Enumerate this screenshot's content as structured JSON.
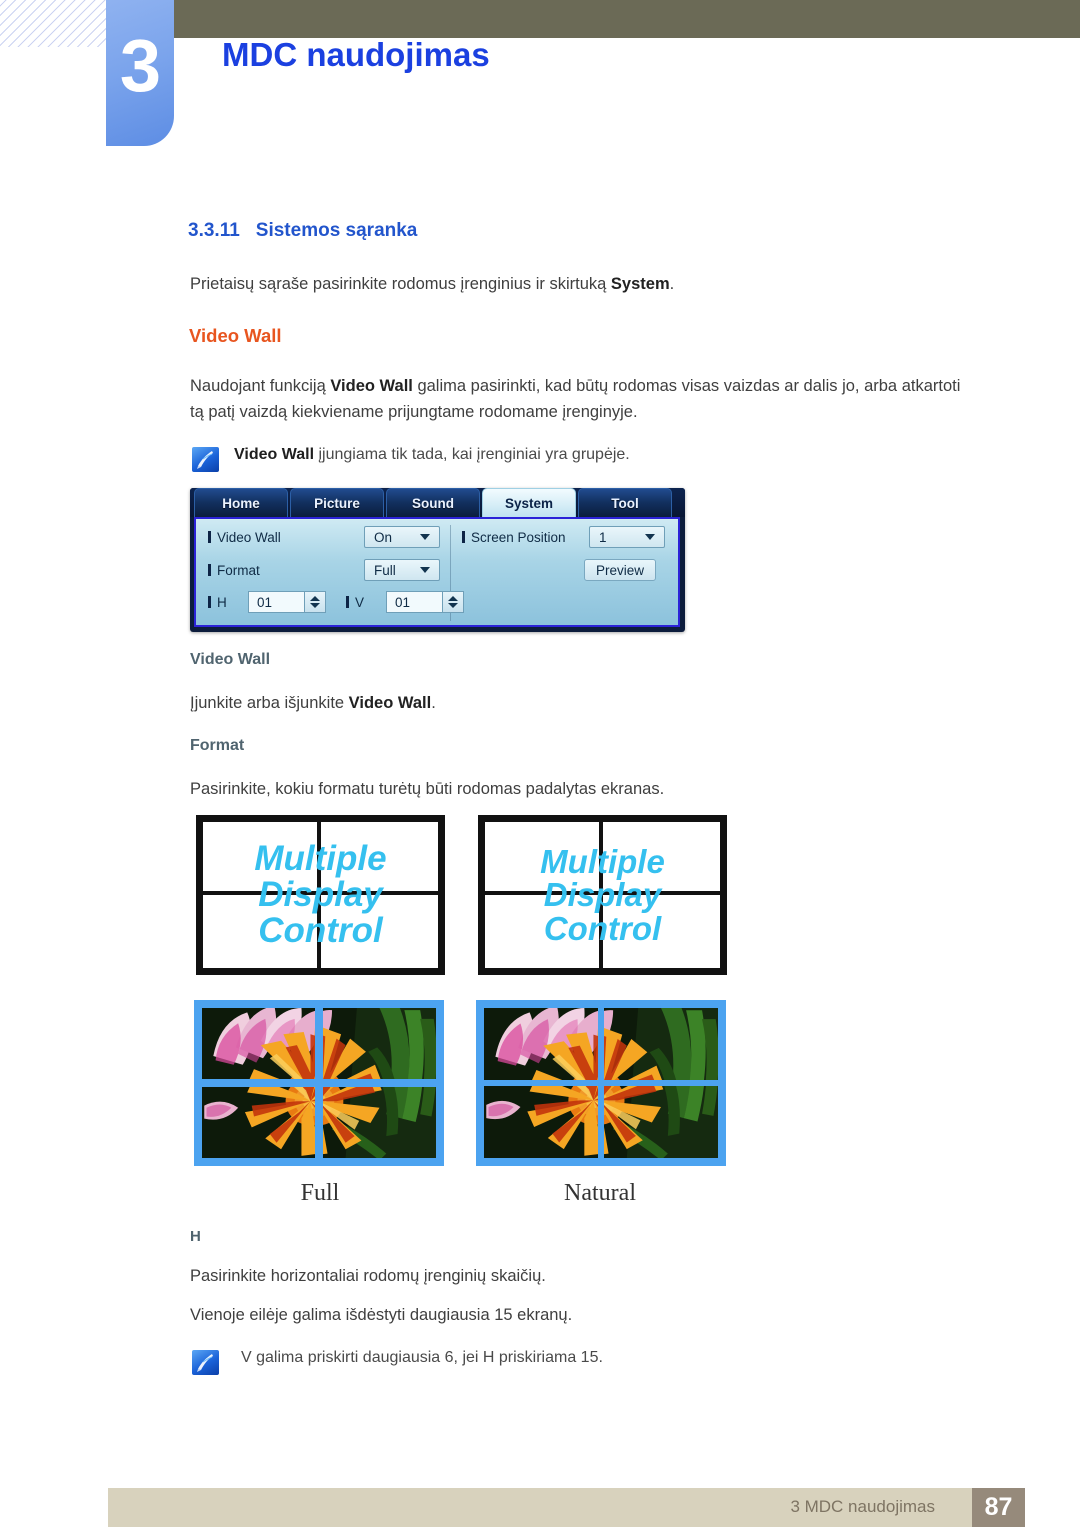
{
  "header": {
    "chapter_number": "3",
    "chapter_title": "MDC naudojimas"
  },
  "section": {
    "number": "3.3.11",
    "title": "Sistemos sąranka",
    "intro_before": "Prietaisų sąraše pasirinkite rodomus įrenginius ir skirtuką ",
    "intro_bold": "System",
    "intro_after": "."
  },
  "video_wall_heading": "Video Wall",
  "video_wall_para_line1_a": "Naudojant funkciją ",
  "video_wall_para_line1_b": "Video Wall",
  "video_wall_para_line1_c": " galima pasirinkti, kad būtų rodomas visas vaizdas ar dalis jo, arba atkartoti",
  "video_wall_para_line2": "tą patį vaizdą kiekviename prijungtame rodomame įrenginyje.",
  "note1": {
    "icon": "note-pen-icon",
    "bold": "Video Wall",
    "rest": " įjungiama tik tada, kai įrenginiai yra grupėje."
  },
  "mdc_panel": {
    "tabs": [
      {
        "label": "Home",
        "active": false
      },
      {
        "label": "Picture",
        "active": false
      },
      {
        "label": "Sound",
        "active": false
      },
      {
        "label": "System",
        "active": true
      },
      {
        "label": "Tool",
        "active": false
      }
    ],
    "fields": {
      "video_wall_label": "Video Wall",
      "video_wall_value": "On",
      "format_label": "Format",
      "format_value": "Full",
      "h_label": "H",
      "h_value": "01",
      "v_label": "V",
      "v_value": "01",
      "screen_position_label": "Screen Position",
      "screen_position_value": "1",
      "preview_button": "Preview"
    }
  },
  "subsections": {
    "video_wall": {
      "heading": "Video Wall",
      "body_a": "Įjunkite arba išjunkite ",
      "body_b": "Video Wall",
      "body_c": "."
    },
    "format": {
      "heading": "Format",
      "body": "Pasirinkite, kokiu formatu turėtų būti rodomas padalytas ekranas."
    },
    "h": {
      "heading": "H",
      "body_line1": "Pasirinkite horizontaliai rodomų įrenginių skaičių.",
      "body_line2": "Vienoje eilėje galima išdėstyti daugiausia 15 ekranų."
    }
  },
  "diagrams": {
    "wall_text_lines": [
      "Multiple",
      "Display",
      "Control"
    ],
    "wall_text_color": "#35c0ef",
    "captions": [
      "Full",
      "Natural"
    ],
    "photo_border_color": "#4ca3f0"
  },
  "note2": {
    "icon": "note-pen-icon",
    "text": "V galima priskirti daugiausia 6, jei H priskiriama 15."
  },
  "footer": {
    "text": "3 MDC naudojimas",
    "page": "87",
    "bar_color": "#d8d2bd",
    "page_box_color": "#968a7b"
  }
}
